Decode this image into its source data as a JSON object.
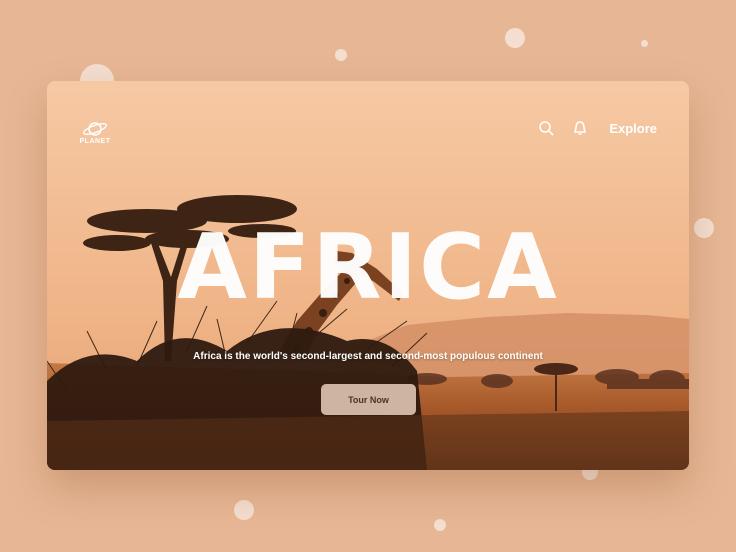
{
  "brand": {
    "logo_text": "PLANET"
  },
  "nav": {
    "search_icon": "search-icon",
    "bell_icon": "bell-icon",
    "explore_label": "Explore"
  },
  "hero": {
    "title": "AFRICA",
    "tagline": "Africa is the world's second-largest and second-most populous continent",
    "cta_label": "Tour Now"
  },
  "colors": {
    "background": "#e7b795",
    "sky": "#f2b98c",
    "savanna": "#a85a2a",
    "accent_text": "#ffffff"
  }
}
